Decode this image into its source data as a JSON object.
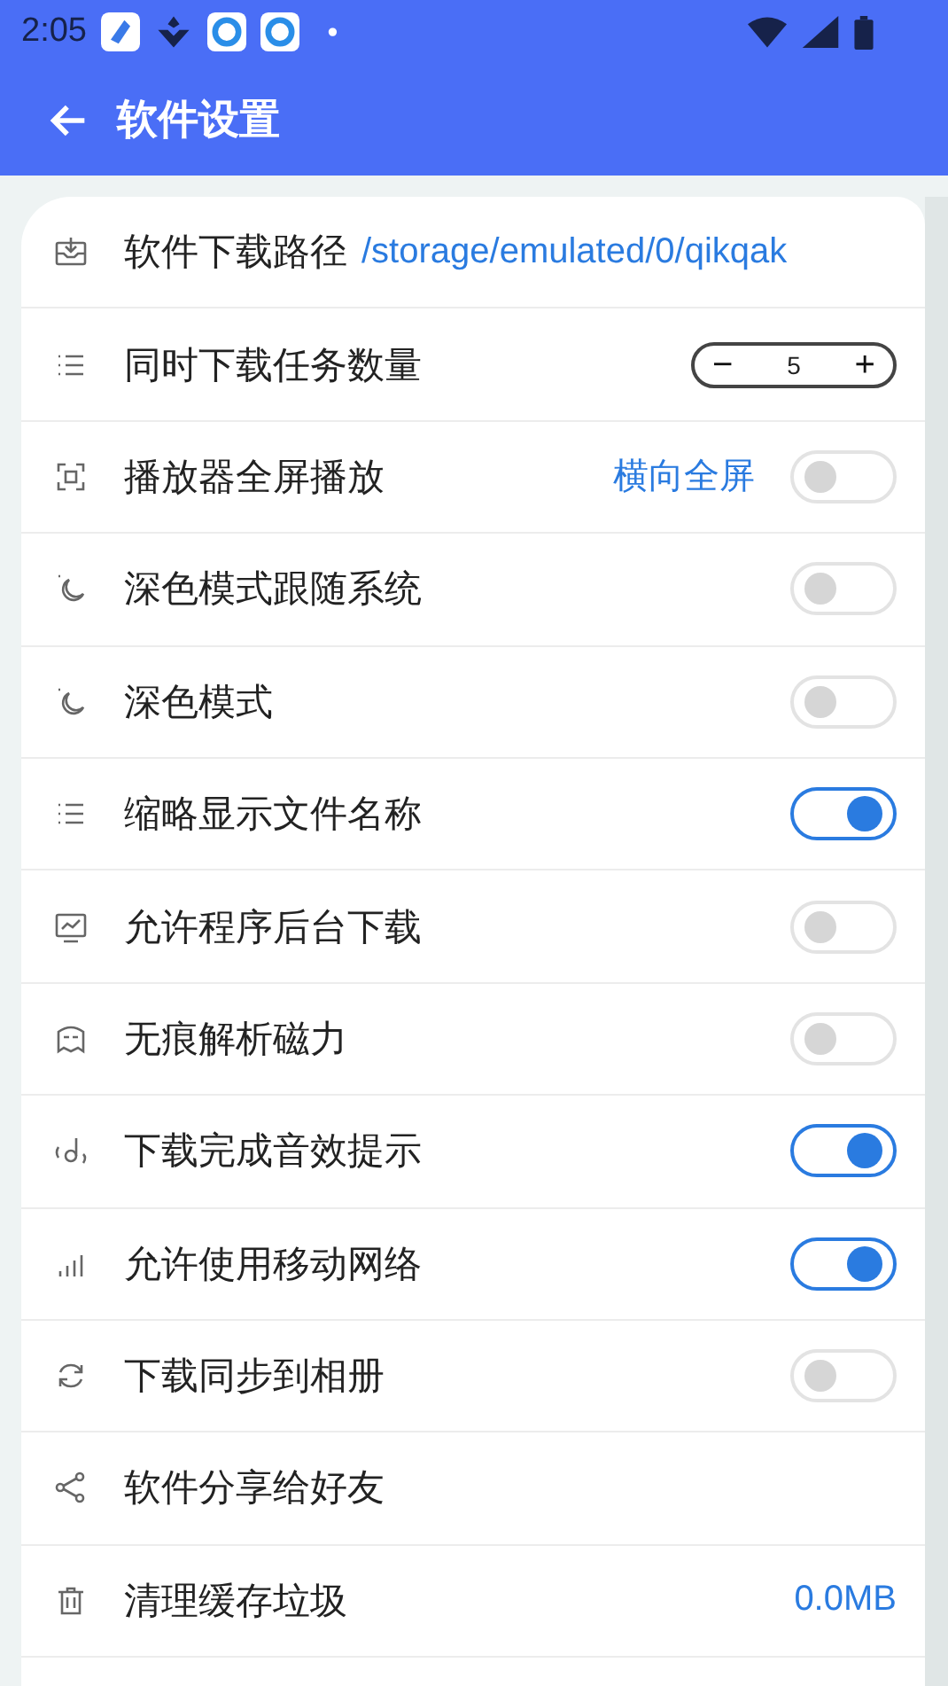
{
  "status_bar": {
    "time": "2:05",
    "dot": "•"
  },
  "header": {
    "title": "软件设置"
  },
  "settings": [
    {
      "kind": "path",
      "label": "软件下载路径",
      "value": "/storage/emulated/0/qikqak"
    },
    {
      "kind": "stepper",
      "label": "同时下载任务数量",
      "minus": "−",
      "count": "5",
      "plus": "+"
    },
    {
      "kind": "toggle",
      "label": "播放器全屏播放",
      "value": "横向全屏",
      "on": false
    },
    {
      "kind": "toggle",
      "label": "深色模式跟随系统",
      "on": false
    },
    {
      "kind": "toggle",
      "label": "深色模式",
      "on": false
    },
    {
      "kind": "toggle",
      "label": "缩略显示文件名称",
      "on": true
    },
    {
      "kind": "toggle",
      "label": "允许程序后台下载",
      "on": false
    },
    {
      "kind": "toggle",
      "label": "无痕解析磁力",
      "on": false
    },
    {
      "kind": "toggle",
      "label": "下载完成音效提示",
      "on": true
    },
    {
      "kind": "toggle",
      "label": "允许使用移动网络",
      "on": true
    },
    {
      "kind": "toggle",
      "label": "下载同步到相册",
      "on": false
    },
    {
      "kind": "plain",
      "label": "软件分享给好友"
    },
    {
      "kind": "value",
      "label": "清理缓存垃圾",
      "value": "0.0MB"
    }
  ]
}
